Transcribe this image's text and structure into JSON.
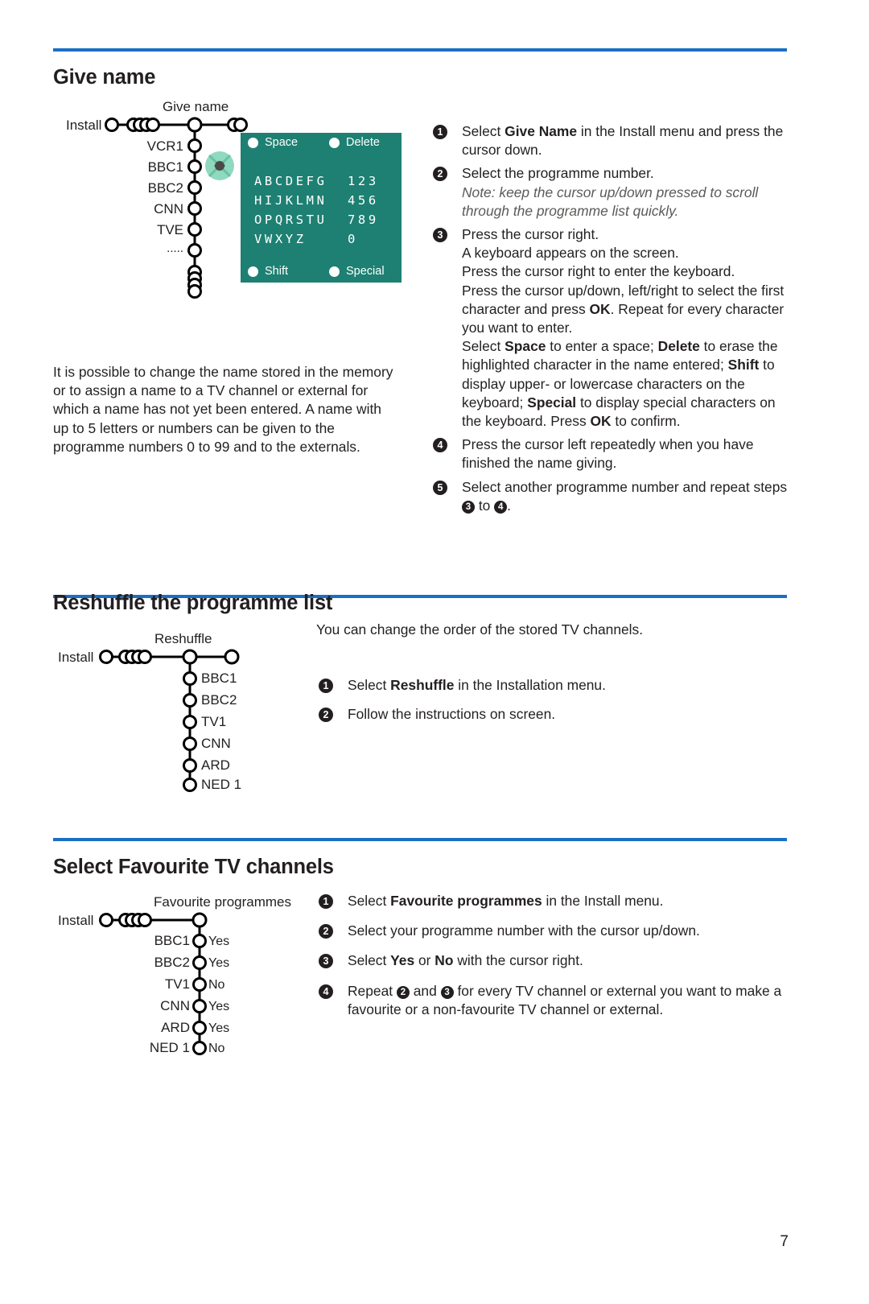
{
  "page": {
    "number": "7",
    "accent_color": "#1a6fc4",
    "osd_color": "#1d8072",
    "text_color": "#231f20"
  },
  "sections": {
    "give_name": {
      "heading": "Give name",
      "tree": {
        "root_label": "Install",
        "title": "Give name",
        "items": [
          "VCR1",
          "BBC1",
          "BBC2",
          "CNN",
          "TVE",
          "....."
        ]
      },
      "osd": {
        "space_label": "Space",
        "delete_label": "Delete",
        "shift_label": "Shift",
        "special_label": "Special",
        "letter_rows": [
          "ABCDEFG",
          "HIJKLMN",
          "OPQRSTU",
          "VWXYZ"
        ],
        "number_rows": [
          "123",
          "456",
          "789",
          "0"
        ]
      },
      "body_paragraph": "It is possible to change the name stored in the memory or to assign a name to a TV channel or external for which a name has not yet been entered. A name with up to 5 letters or numbers can be given to the programme numbers 0 to 99 and to the externals.",
      "steps": [
        {
          "num": "1",
          "html": "Select <b>Give Name</b> in the Install menu and press the cursor down."
        },
        {
          "num": "2",
          "html": "Select the programme number.<br><span class=\"note\">Note: keep the cursor up/down pressed to scroll through the programme list quickly.</span>"
        },
        {
          "num": "3",
          "html": "Press the cursor right.<br>A keyboard appears on the screen.<br>Press the cursor right to enter the keyboard.<br>Press the cursor up/down, left/right to select the first character and press <b>OK</b>. Repeat for every character you want to enter.<br>Select <b>Space</b> to enter a space; <b>Delete</b> to erase the highlighted character in the name entered; <b>Shift</b> to display upper- or lowercase characters on the keyboard; <b>Special</b> to display special characters on the keyboard. Press <b>OK</b> to confirm."
        },
        {
          "num": "4",
          "html": "Press the cursor left repeatedly when you have finished the name giving."
        },
        {
          "num": "5",
          "html": "Select another programme number and repeat steps <span class=\"inum\">3</span> to <span class=\"inum\">4</span>."
        }
      ]
    },
    "reshuffle": {
      "heading": "Reshuffle the programme list",
      "tree": {
        "root_label": "Install",
        "title": "Reshuffle",
        "items": [
          "BBC1",
          "BBC2",
          "TV1",
          "CNN",
          "ARD",
          "NED 1"
        ]
      },
      "intro": "You can change the order of the stored TV channels.",
      "steps": [
        {
          "num": "1",
          "html": "Select <b>Reshuffle</b> in the Installation menu."
        },
        {
          "num": "2",
          "html": "Follow the instructions on screen."
        }
      ]
    },
    "favourite": {
      "heading": "Select Favourite TV channels",
      "tree": {
        "root_label": "Install",
        "title": "Favourite programmes",
        "items": [
          {
            "name": "BBC1",
            "value": "Yes"
          },
          {
            "name": "BBC2",
            "value": "Yes"
          },
          {
            "name": "TV1",
            "value": "No"
          },
          {
            "name": "CNN",
            "value": "Yes"
          },
          {
            "name": "ARD",
            "value": "Yes"
          },
          {
            "name": "NED 1",
            "value": "No"
          }
        ]
      },
      "steps": [
        {
          "num": "1",
          "html": "Select <b>Favourite programmes</b> in the Install menu."
        },
        {
          "num": "2",
          "html": "Select your programme number with the cursor up/down."
        },
        {
          "num": "3",
          "html": "Select <b>Yes</b> or <b>No</b> with the cursor right."
        },
        {
          "num": "4",
          "html": "Repeat <span class=\"inum\">2</span> and <span class=\"inum\">3</span> for every TV channel or external you want to make a favourite or a non-favourite TV channel or external."
        }
      ]
    }
  }
}
